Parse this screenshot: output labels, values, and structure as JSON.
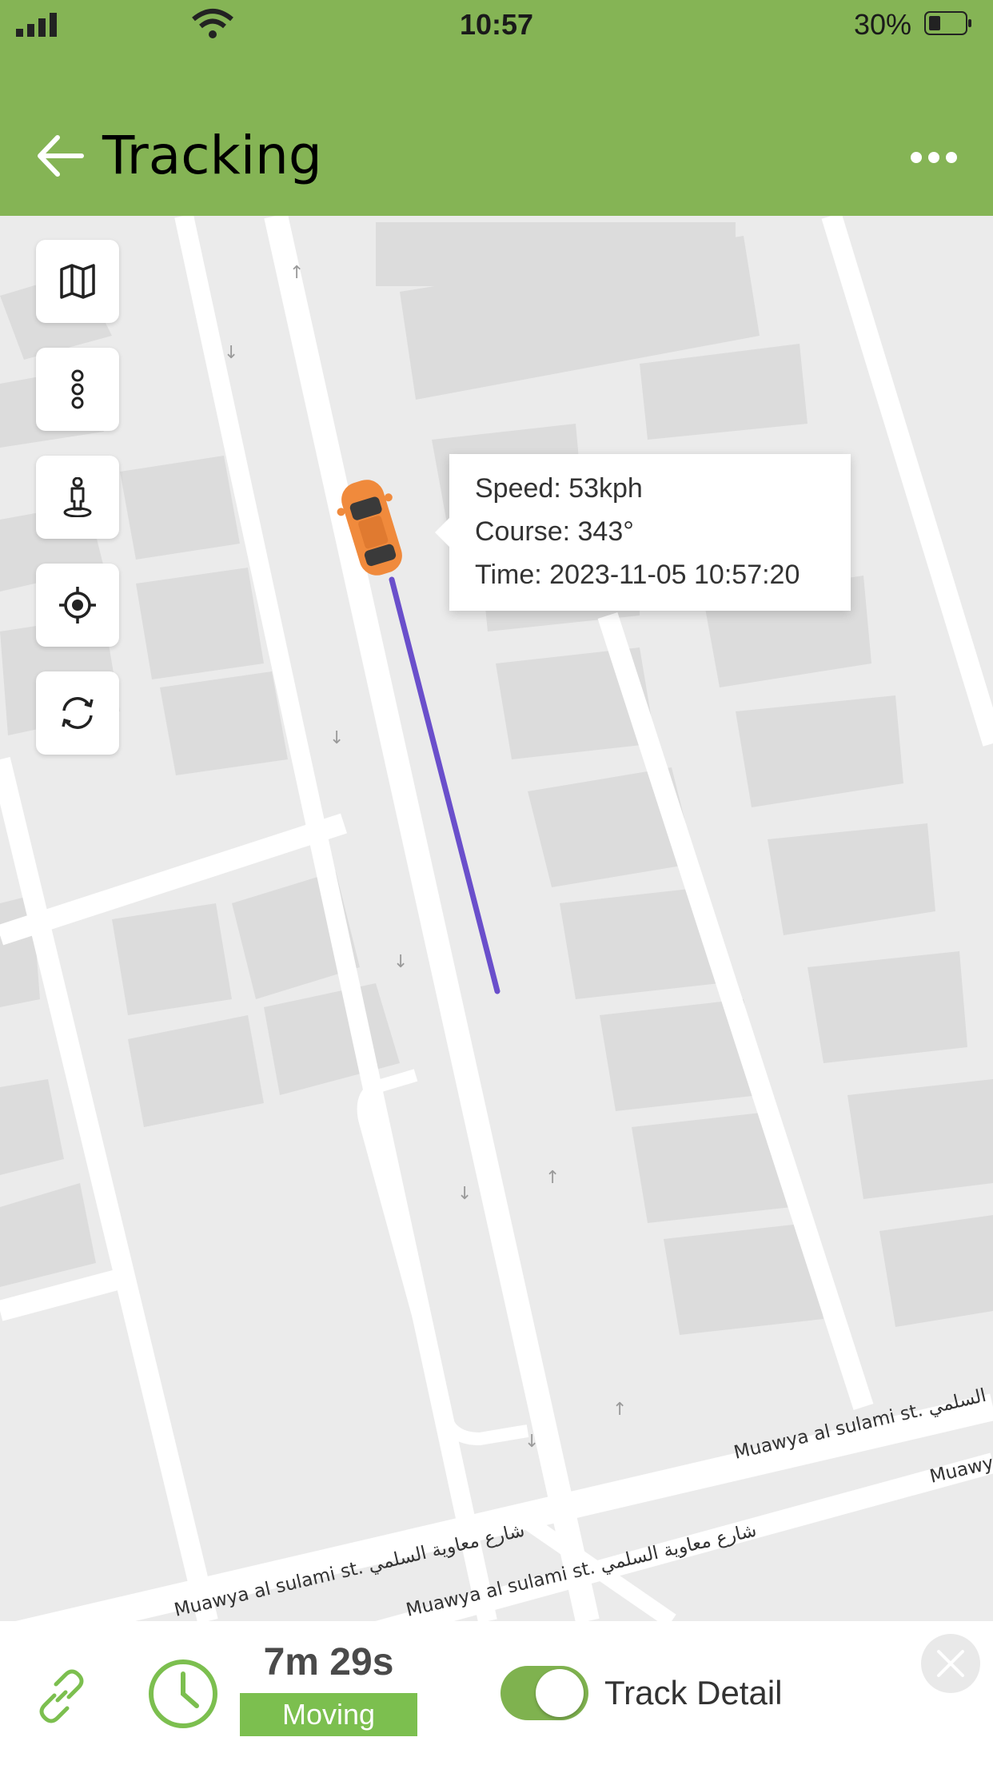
{
  "status_bar": {
    "time": "10:57",
    "battery": "30%"
  },
  "header": {
    "title": "Tracking"
  },
  "map": {
    "popup": {
      "speed": "Speed: 53kph",
      "course": "Course: 343°",
      "time": "Time: 2023-11-05 10:57:20"
    },
    "street_labels": {
      "right_upper": "Muawya al sulami st. شارع معاوية السلمي",
      "right_lower": "Muawya",
      "left_upper": "Muawya al sulami st. شارع معاوية السلمي",
      "left_lower": "Muawya al sulami st. شارع معاوية السلمي"
    },
    "controls": [
      "map-layers-icon",
      "traffic-light-icon",
      "street-view-icon",
      "locate-icon",
      "refresh-icon"
    ]
  },
  "bottom_bar": {
    "duration": "7m 29s",
    "status": "Moving",
    "track_detail_label": "Track Detail",
    "track_detail_enabled": true
  },
  "colors": {
    "header": "#85b455",
    "route": "#6a4fcb",
    "car": "#f08a3c",
    "moving_badge": "#7cbf4f"
  }
}
